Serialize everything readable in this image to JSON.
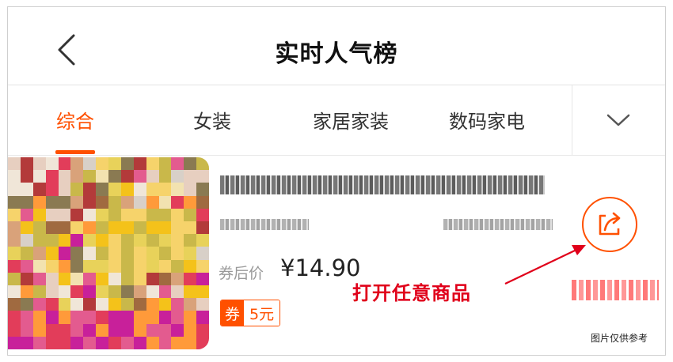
{
  "header": {
    "title": "实时人气榜",
    "back_icon": "chevron-left-icon"
  },
  "tabs": [
    {
      "label": "综合",
      "active": true
    },
    {
      "label": "女装",
      "active": false
    },
    {
      "label": "家居家装",
      "active": false
    },
    {
      "label": "数码家电",
      "active": false
    }
  ],
  "tabs_dropdown_icon": "chevron-down-icon",
  "product": {
    "price_label": "券后价",
    "price_value": "¥14.90",
    "coupon_tag": "券",
    "coupon_amount": "5元",
    "share_icon": "share-icon"
  },
  "annotation": {
    "text": "打开任意商品",
    "color": "#e0001a"
  },
  "disclaimer": "图片仅供参考",
  "colors": {
    "accent": "#ff5000",
    "annotation_red": "#e0001a"
  }
}
